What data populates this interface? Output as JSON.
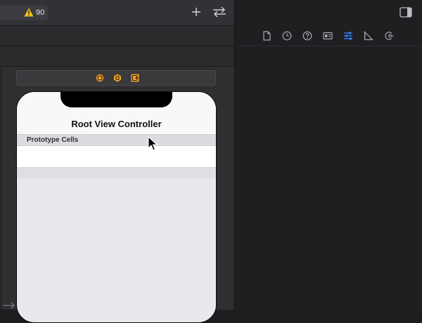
{
  "toolbar": {
    "issue_count": "90"
  },
  "scene": {
    "nav_title": "Root View Controller",
    "prototype_cells_label": "Prototype Cells"
  },
  "colors": {
    "warning": "#f5c518",
    "dock_icon": "#f0a02a",
    "inspector_active": "#2f86f6"
  },
  "icons": {
    "inspector_tabs": [
      "file-inspector-icon",
      "history-inspector-icon",
      "quick-help-icon",
      "identity-inspector-icon",
      "attributes-inspector-icon",
      "size-inspector-icon",
      "connections-inspector-icon"
    ]
  }
}
